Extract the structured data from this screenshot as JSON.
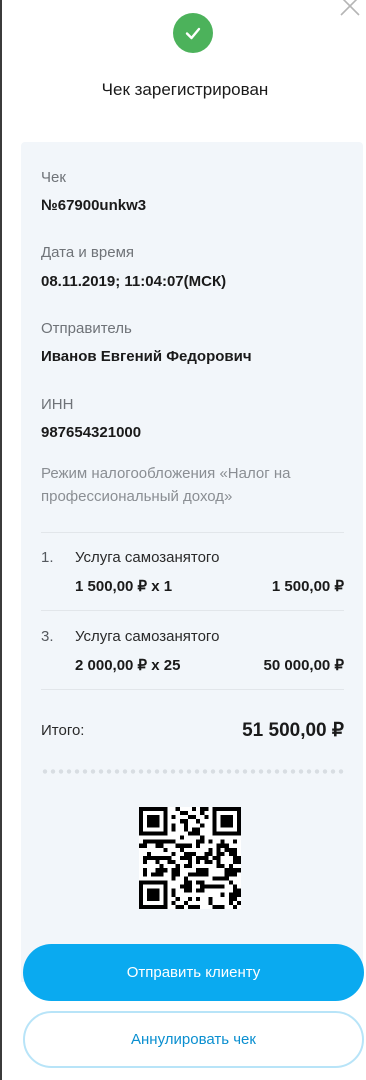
{
  "header": {
    "title": "Чек зарегистрирован"
  },
  "receipt": {
    "number_label": "Чек",
    "number_value": "№67900unkw3",
    "datetime_label": "Дата и время",
    "datetime_value": "08.11.2019; 11:04:07(МСК)",
    "sender_label": "Отправитель",
    "sender_value": "Иванов Евгений Федорович",
    "inn_label": "ИНН",
    "inn_value": "987654321000",
    "tax_regime": "Режим налогообложения «Налог на профессиональный доход»",
    "items": [
      {
        "num": "1.",
        "name": "Услуга самозанятого",
        "qty": "1 500,00 ₽ х 1",
        "sum": "1 500,00 ₽"
      },
      {
        "num": "3.",
        "name": "Услуга самозанятого",
        "qty": "2 000,00 ₽ х 25",
        "sum": "50 000,00 ₽"
      }
    ],
    "total_label": "Итого:",
    "total_value": "51 500,00 ₽"
  },
  "actions": {
    "send_label": "Отправить клиенту",
    "cancel_label": "Аннулировать чек"
  },
  "colors": {
    "accent": "#0aaaf0",
    "success": "#4cb25b",
    "card_bg": "#f2f6fa"
  },
  "icons": {
    "close": "close-icon",
    "success": "check-circle-icon",
    "qr": "qr-code"
  }
}
